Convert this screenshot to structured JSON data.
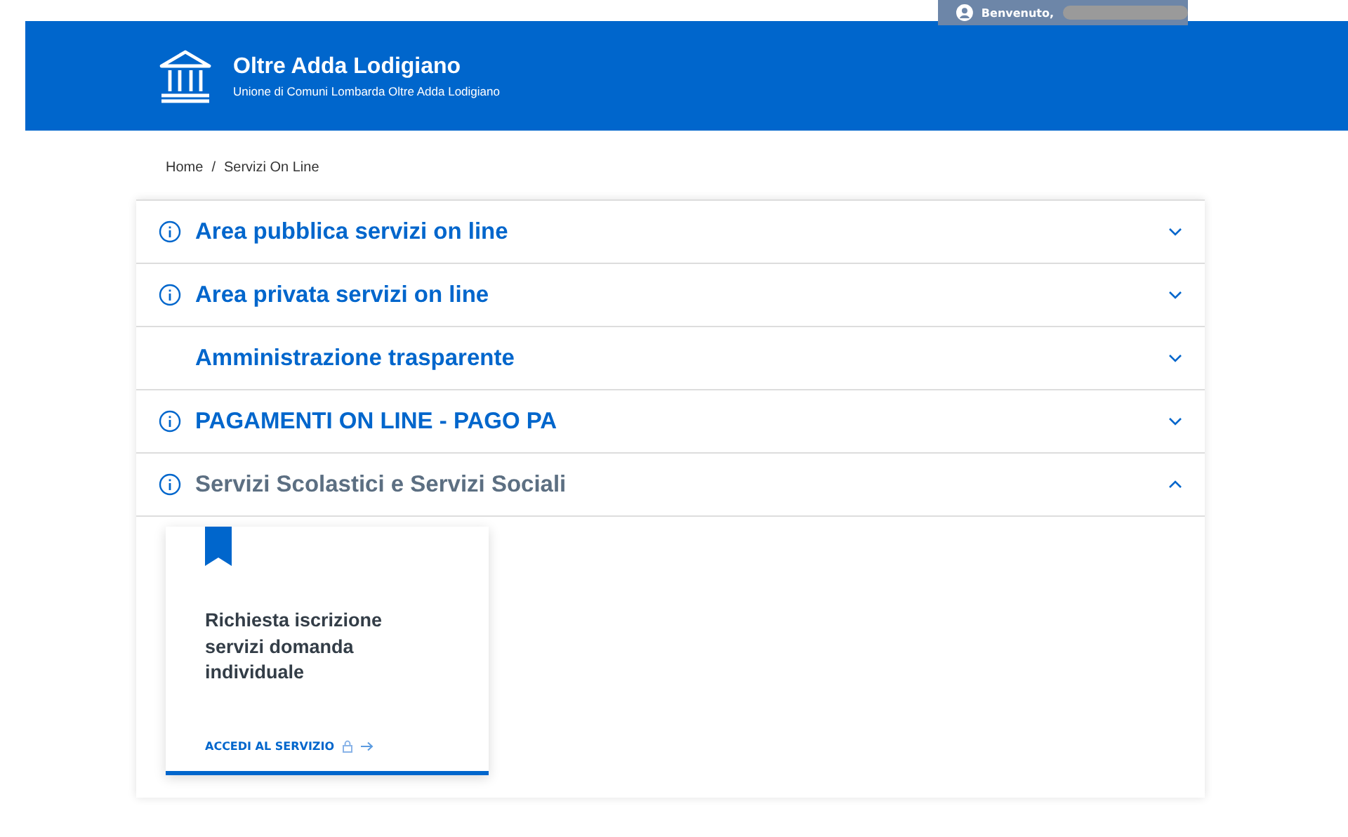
{
  "user_bar": {
    "greeting": "Benvenuto,"
  },
  "header": {
    "title": "Oltre Adda Lodigiano",
    "subtitle": "Unione di Comuni Lombarda Oltre Adda Lodigiano"
  },
  "breadcrumb": {
    "items": [
      "Home",
      "Servizi On Line"
    ],
    "separator": "/"
  },
  "sections": [
    {
      "title": "Area pubblica servizi on line",
      "info_icon": true,
      "expanded": false
    },
    {
      "title": "Area privata servizi on line",
      "info_icon": true,
      "expanded": false
    },
    {
      "title": "Amministrazione trasparente",
      "info_icon": false,
      "expanded": false
    },
    {
      "title": "PAGAMENTI ON LINE - PAGO PA",
      "info_icon": true,
      "expanded": false
    },
    {
      "title": "Servizi Scolastici e Servizi Sociali",
      "info_icon": true,
      "expanded": true,
      "cards": [
        {
          "title": "Richiesta iscrizione servizi domanda individuale",
          "link": "ACCEDI AL SERVIZIO",
          "locked": true
        }
      ]
    }
  ]
}
